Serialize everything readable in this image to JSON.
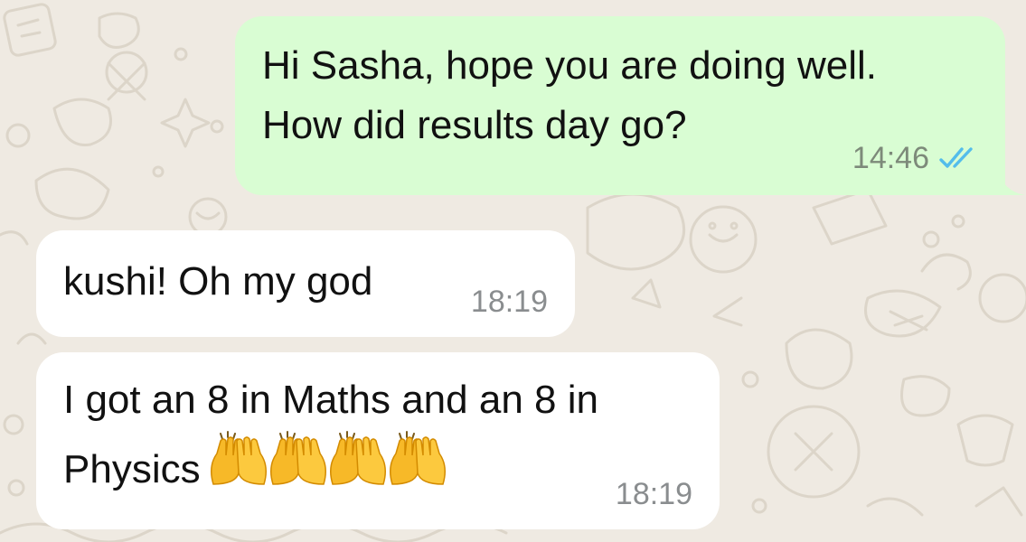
{
  "chat": {
    "messages": [
      {
        "direction": "outgoing",
        "lines": [
          "Hi Sasha, hope you are doing well.",
          "How did results day go?"
        ],
        "time": "14:46",
        "status_icon": "double-check-read-icon"
      },
      {
        "direction": "incoming",
        "lines": [
          "kushi! Oh my god"
        ],
        "time": "18:19"
      },
      {
        "direction": "incoming",
        "lines": [
          "I got an 8 in Maths and an 8 in",
          "Physics"
        ],
        "emoji": [
          "raising-hands-emoji",
          "raising-hands-emoji",
          "raising-hands-emoji",
          "raising-hands-emoji"
        ],
        "time": "18:19"
      }
    ]
  },
  "colors": {
    "wallpaper": "#efeae2",
    "outgoing_bubble": "#d9fdd3",
    "incoming_bubble": "#ffffff",
    "read_ticks": "#53bdeb",
    "timestamp": "#8a8d8f"
  }
}
